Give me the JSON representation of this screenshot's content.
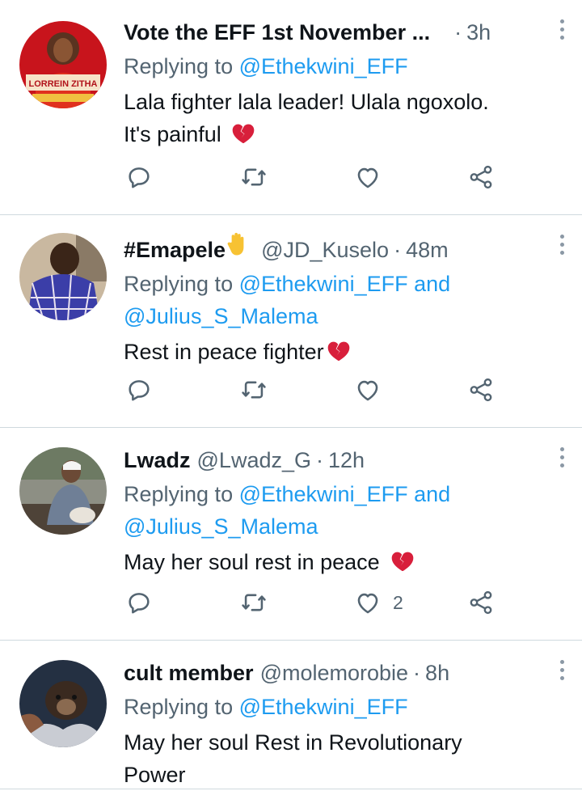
{
  "icons": {
    "reply": "reply-icon",
    "retweet": "retweet-icon",
    "like": "like-icon",
    "share": "share-icon",
    "more": "more-icon",
    "broken_heart": "broken-heart-emoji",
    "raised_hand": "raised-hand-emoji"
  },
  "colors": {
    "link": "#1d9bf0",
    "muted": "#536471",
    "text": "#0f1419",
    "heart": "#d81f3b"
  },
  "tweets": [
    {
      "name": "Vote the EFF 1st November ...",
      "handle": "",
      "dot": "·",
      "time": "3h",
      "reply_prefix": "Replying to",
      "reply_to": "@Ethekwini_EFF",
      "reply_and": "",
      "reply_to2": "",
      "text_line1": "Lala fighter lala leader! Ulala ngoxolo.",
      "text_line2": "It's painful",
      "likes": "",
      "avatar_caption": "LORREIN ZITHA"
    },
    {
      "name": "#Emapele",
      "handle": "@JD_Kuselo",
      "dot": "·",
      "time": "48m",
      "reply_prefix": "Replying to",
      "reply_to": "@Ethekwini_EFF",
      "reply_and": "and",
      "reply_to2": "@Julius_S_Malema",
      "text_line1": "Rest in peace fighter",
      "text_line2": "",
      "likes": ""
    },
    {
      "name": "Lwadz",
      "handle": "@Lwadz_G",
      "dot": "·",
      "time": "12h",
      "reply_prefix": "Replying to",
      "reply_to": "@Ethekwini_EFF",
      "reply_and": "and",
      "reply_to2": "@Julius_S_Malema",
      "text_line1": "May her soul rest in peace",
      "text_line2": "",
      "likes": "2"
    },
    {
      "name": "cult member",
      "handle": "@molemorobie",
      "dot": "·",
      "time": "8h",
      "reply_prefix": "Replying to",
      "reply_to": "@Ethekwini_EFF",
      "reply_and": "",
      "reply_to2": "",
      "text_line1": "May her soul Rest in Revolutionary",
      "text_line2": "Power",
      "likes": ""
    }
  ]
}
